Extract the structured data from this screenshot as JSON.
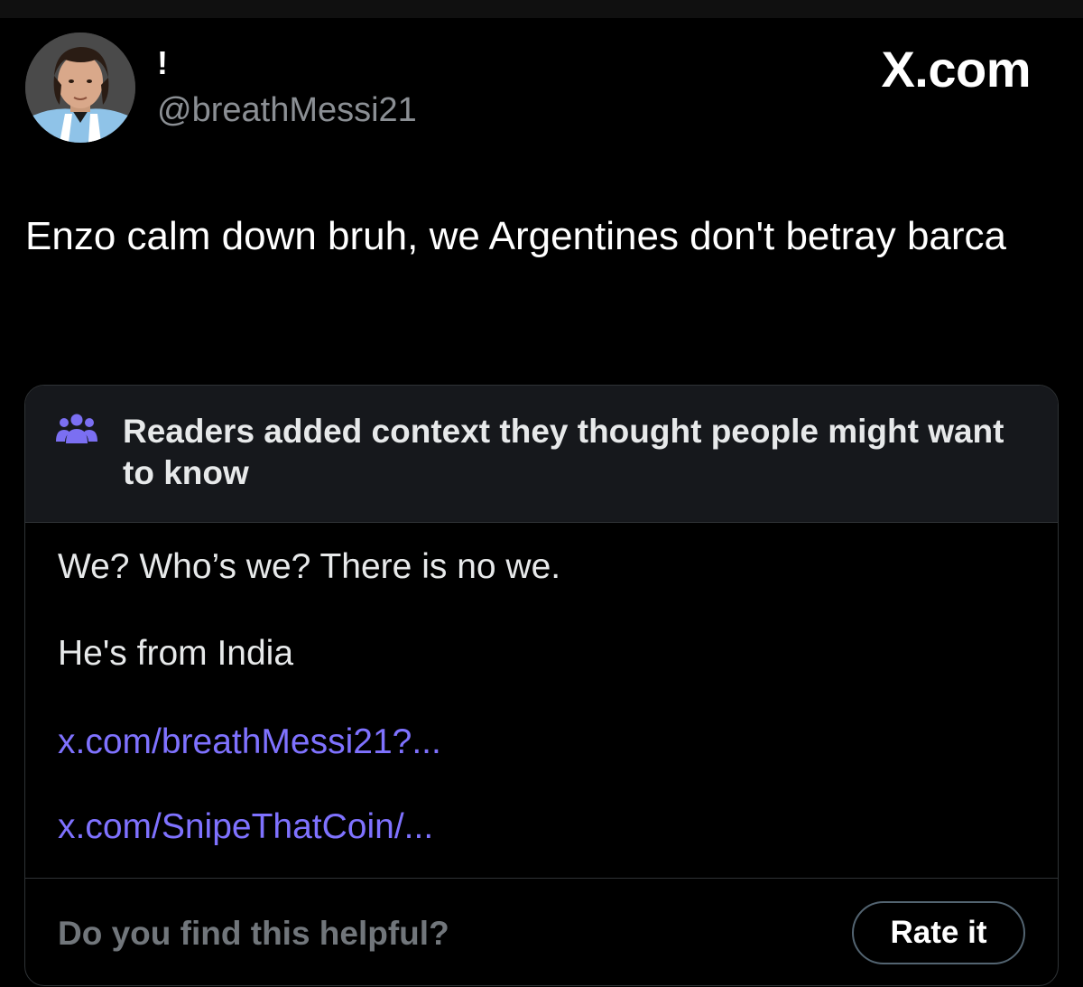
{
  "tweet": {
    "display_name": "!",
    "handle": "@breathMessi21",
    "text": "Enzo calm down bruh, we Argentines don't betray barca"
  },
  "brand": {
    "label": "X.com"
  },
  "community_note": {
    "icon": "people-icon",
    "title": "Readers added context they thought people might want to know",
    "body_lines": [
      "We? Who’s we? There is no we.",
      "He's from India"
    ],
    "links": [
      "x.com/breathMessi21?...",
      "x.com/SnipeThatCoin/..."
    ],
    "helpful_question": "Do you find this helpful?",
    "rate_button_label": "Rate it"
  },
  "colors": {
    "background": "#000000",
    "note_header_bg": "#16181c",
    "link": "#7f72ff",
    "icon_purple": "#7b6ff2",
    "muted_text": "#71767b"
  }
}
